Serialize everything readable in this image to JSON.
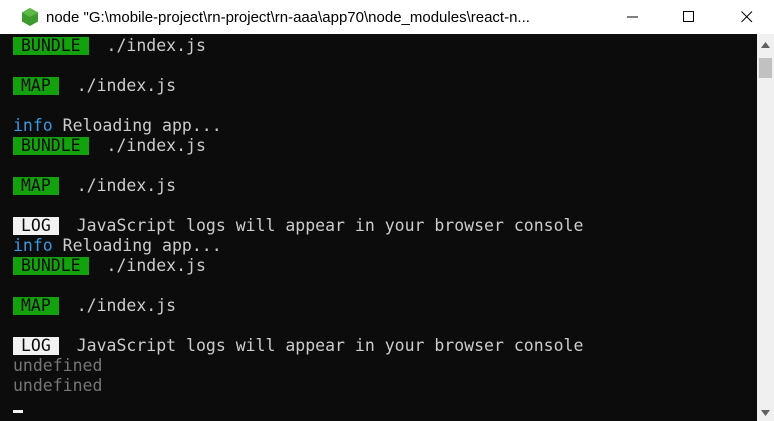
{
  "window": {
    "title": "node \"G:\\mobile-project\\rn-project\\rn-aaa\\app70\\node_modules\\react-n...",
    "icons": {
      "app": "node-hexagon-icon",
      "minimize": "minimize-icon",
      "maximize": "maximize-icon",
      "close": "close-icon"
    }
  },
  "colors": {
    "console_bg": "#0c0c0c",
    "tag_green": "#13a10e",
    "tag_log": "#f2f2f2",
    "info_blue": "#3a96dd"
  },
  "console": {
    "lines": [
      {
        "tag": "BUNDLE",
        "text": " ./index.js"
      },
      {
        "text": ""
      },
      {
        "tag": "MAP",
        "text": " ./index.js"
      },
      {
        "text": ""
      },
      {
        "prefix": "info",
        "text": " Reloading app..."
      },
      {
        "tag": "BUNDLE",
        "text": " ./index.js"
      },
      {
        "text": ""
      },
      {
        "tag": "MAP",
        "text": " ./index.js"
      },
      {
        "text": ""
      },
      {
        "tag": "LOG",
        "text": " JavaScript logs will appear in your browser console"
      },
      {
        "prefix": "info",
        "text": " Reloading app..."
      },
      {
        "tag": "BUNDLE",
        "text": " ./index.js"
      },
      {
        "text": ""
      },
      {
        "tag": "MAP",
        "text": " ./index.js"
      },
      {
        "text": ""
      },
      {
        "tag": "LOG",
        "text": " JavaScript logs will appear in your browser console"
      },
      {
        "muted": "undefined"
      },
      {
        "muted": "undefined"
      }
    ]
  }
}
